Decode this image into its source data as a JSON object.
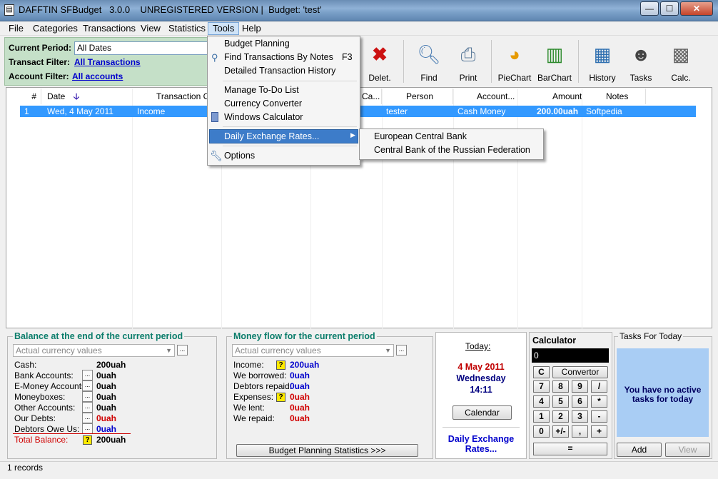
{
  "window": {
    "title": "DAFFTIN SFBudget   3.0.0    UNREGISTERED VERSION |  Budget: 'test'",
    "app_icon": "ledger-icon",
    "minimize": "—",
    "maximize": "☐",
    "close": "✕"
  },
  "menubar": {
    "items": [
      "File",
      "Categories",
      "Transactions",
      "View",
      "Statistics",
      "Tools",
      "Help"
    ]
  },
  "filters": {
    "period_label": "Current Period:",
    "period_value": "All Dates",
    "transact_label": "Transact Filter:",
    "transact_value": "All Transactions",
    "account_label": "Account Filter:",
    "account_value": "All accounts"
  },
  "toolbar": {
    "delete": "Delet.",
    "find": "Find",
    "print": "Print",
    "piechart": "PieChart",
    "barchart": "BarChart",
    "history": "History",
    "tasks": "Tasks",
    "calc": "Calc."
  },
  "grid": {
    "headers": [
      "#",
      "Date",
      "Transaction Ca",
      "Ca...",
      "Person",
      "Account...",
      "Amount",
      "Notes"
    ],
    "rows": [
      {
        "num": "1",
        "date": "Wed, 4 May 2011",
        "category": "Income",
        "person": "tester",
        "account": "Cash Money",
        "amount": "200.00uah",
        "notes": "Softpedia"
      }
    ]
  },
  "tools_menu": {
    "items": [
      "Budget Planning",
      "Find Transactions By Notes",
      "Detailed Transaction History",
      "Manage To-Do List",
      "Currency Converter",
      "Windows Calculator",
      "Daily Exchange Rates...",
      "Options"
    ],
    "shortcut_find": "F3",
    "submenu": [
      "European Central Bank",
      "Central Bank of the Russian Federation"
    ]
  },
  "balance": {
    "title": "Balance at the end of the current period",
    "combo": "Actual currency values",
    "rows": [
      {
        "label": "Cash:",
        "value": "200uah"
      },
      {
        "label": "Bank Accounts:",
        "value": "0uah"
      },
      {
        "label": "E-Money Accounts:",
        "value": "0uah"
      },
      {
        "label": "Moneyboxes:",
        "value": "0uah"
      },
      {
        "label": "Other Accounts:",
        "value": "0uah"
      },
      {
        "label": "Our Debts:",
        "value": "0uah"
      },
      {
        "label": "Debtors Owe Us:",
        "value": "0uah"
      }
    ],
    "total_label": "Total Balance:",
    "total_value": "200uah"
  },
  "moneyflow": {
    "title": "Money flow for the current period",
    "combo": "Actual currency values",
    "rows": [
      {
        "label": "Income:",
        "value": "200uah"
      },
      {
        "label": "We borrowed:",
        "value": "0uah"
      },
      {
        "label": "Debtors repaid:",
        "value": "0uah"
      },
      {
        "label": "Expenses:",
        "value": "0uah"
      },
      {
        "label": "We lent:",
        "value": "0uah"
      },
      {
        "label": "We repaid:",
        "value": "0uah"
      }
    ],
    "stats_button": "Budget Planning Statistics >>>"
  },
  "today": {
    "label": "Today:",
    "date": "4 May 2011",
    "weekday": "Wednesday",
    "time": "14:11",
    "calendar_button": "Calendar",
    "rates_link_1": "Daily Exchange",
    "rates_link_2": "Rates..."
  },
  "calculator": {
    "title": "Calculator",
    "display": "0",
    "clear": "C",
    "convertor": "Convertor",
    "keys": [
      "7",
      "8",
      "9",
      "/",
      "4",
      "5",
      "6",
      "*",
      "1",
      "2",
      "3",
      "-",
      "0",
      "+/-",
      ",",
      "+"
    ],
    "equals": "="
  },
  "tasks": {
    "title": "Tasks For Today",
    "message": "You have no active tasks for today",
    "add": "Add",
    "view": "View"
  },
  "status": {
    "records": "1 records"
  },
  "colors": {
    "selection": "#3399ff",
    "accent_teal": "#0b7d6b",
    "filter_bg": "#c5e0c8"
  }
}
